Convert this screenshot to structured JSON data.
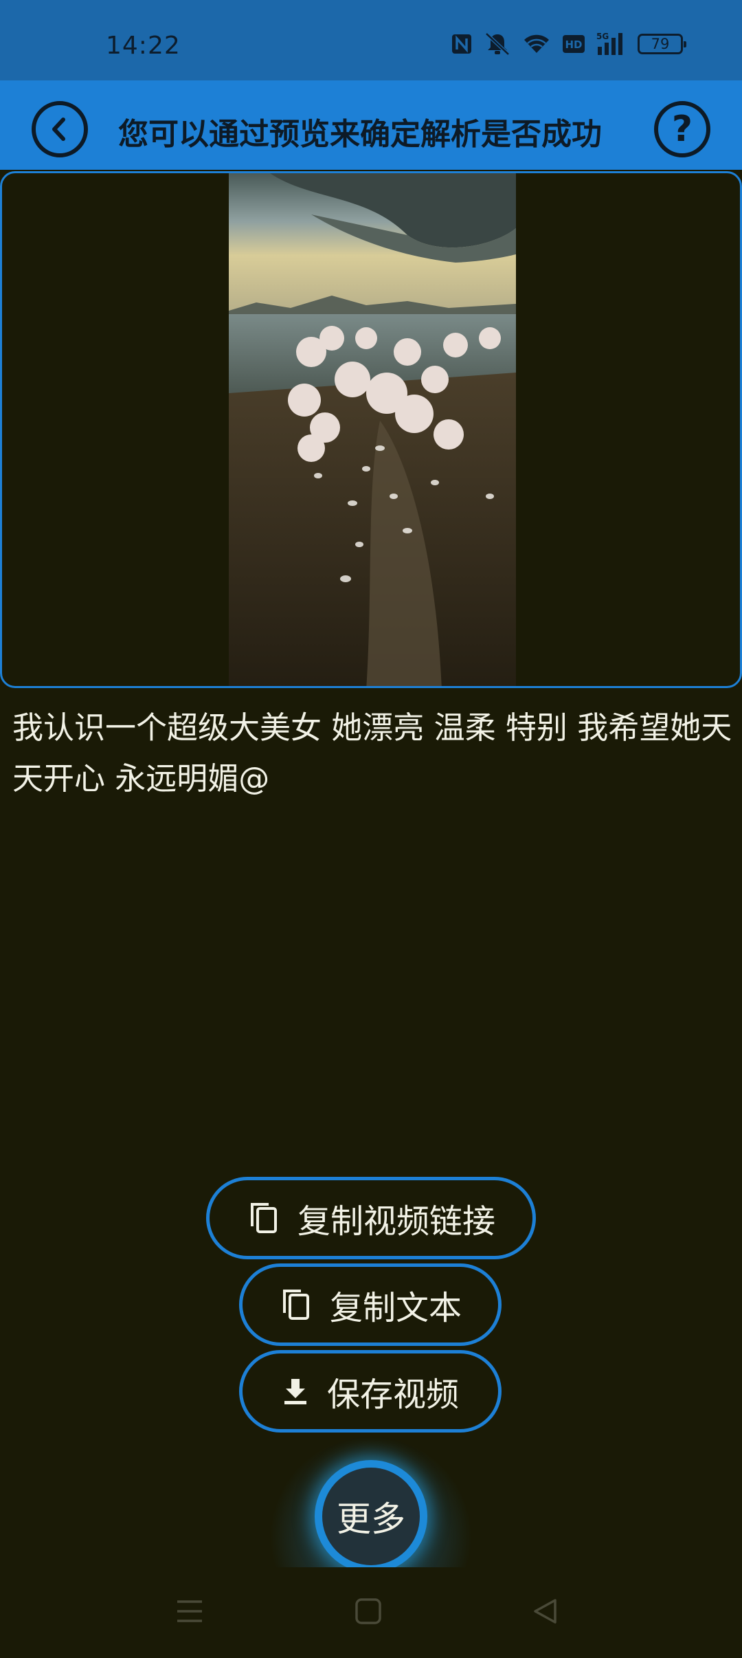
{
  "status_bar": {
    "time": "14:22",
    "battery": "79",
    "icons": [
      "nfc-icon",
      "mute-icon",
      "wifi-icon",
      "hd-icon",
      "signal-5g-icon",
      "battery-icon"
    ]
  },
  "top_bar": {
    "title": "您可以通过预览来确定解析是否成功",
    "back_icon": "chevron-left-icon",
    "help_label": "?"
  },
  "video": {
    "thumbnail": "roses-by-the-lake-image"
  },
  "caption": "我认识一个超级大美女 她漂亮 温柔 特别 我希望她天天开心 永远明媚@",
  "actions": {
    "copy_link": "复制视频链接",
    "copy_text": "复制文本",
    "save_video": "保存视频",
    "more": "更多"
  },
  "nav": {
    "icons": [
      "menu-icon",
      "home-icon",
      "back-triangle-icon"
    ]
  },
  "colors": {
    "accent": "#1d80d6",
    "status_bar": "#1c68aa",
    "background": "#1a1a06",
    "text": "#f2f2e6"
  }
}
